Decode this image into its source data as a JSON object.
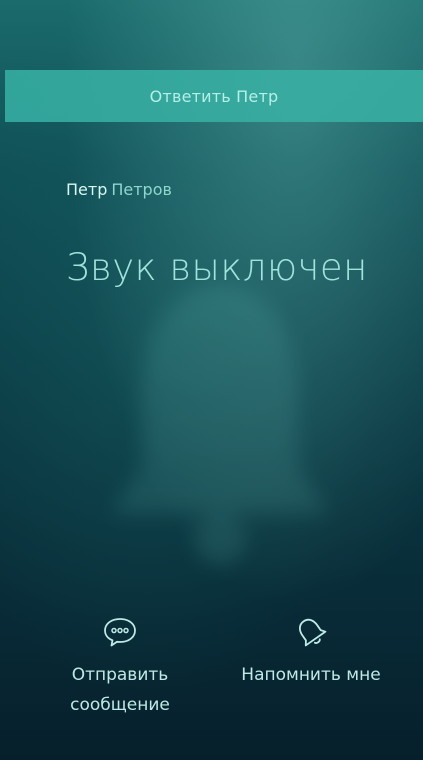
{
  "reply_bar": {
    "label": "Ответить Петр"
  },
  "caller": {
    "first_name": "Петр",
    "last_name": "Петров"
  },
  "status": {
    "text": "Звук выключен"
  },
  "actions": [
    {
      "label_line1": "Отправить",
      "label_line2": "сообщение",
      "icon": "message-bubble-icon"
    },
    {
      "label_line1": "Напомнить мне",
      "label_line2": "",
      "icon": "bell-icon"
    }
  ],
  "colors": {
    "accent": "#3ab2a5",
    "text_primary": "#d9f7f2",
    "text_secondary": "#8fd6cf",
    "background_dark": "#061f2b"
  }
}
